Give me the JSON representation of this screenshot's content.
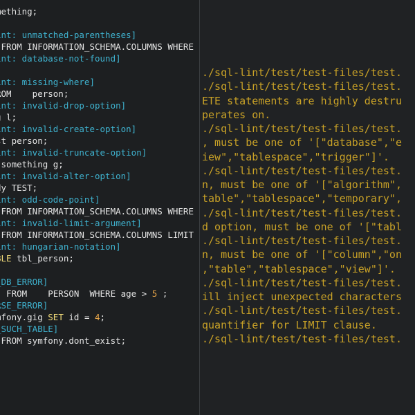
{
  "colors": {
    "background": "#1d1f21",
    "right_background": "#202224",
    "code_text": "#e6e6e6",
    "comment_cyan": "#3fb3d0",
    "keyword": "#f2dc7a",
    "number": "#e9a74a",
    "output_text": "#c9a227"
  },
  "editor": {
    "lines": [
      [
        {
          "t": "mething;",
          "c": "plain"
        }
      ],
      [
        {
          "t": "",
          "c": "plain"
        }
      ],
      [
        {
          "t": "int: unmatched-parentheses]",
          "c": "cyan"
        }
      ],
      [
        {
          "t": " FROM INFORMATION_SCHEMA.COLUMNS WHERE",
          "c": "plain"
        }
      ],
      [
        {
          "t": "int: database-not-found]",
          "c": "cyan"
        }
      ],
      [
        {
          "t": "",
          "c": "plain"
        }
      ],
      [
        {
          "t": "int: missing-where]",
          "c": "cyan"
        }
      ],
      [
        {
          "t": "ROM    person;",
          "c": "plain"
        }
      ],
      [
        {
          "t": "int: invalid-drop-option]",
          "c": "cyan"
        }
      ],
      [
        {
          "t": "g l;",
          "c": "plain"
        }
      ],
      [
        {
          "t": "int: invalid-create-option]",
          "c": "cyan"
        }
      ],
      [
        {
          "t": "st person;",
          "c": "plain"
        }
      ],
      [
        {
          "t": "int: invalid-truncate-option]",
          "c": "cyan"
        }
      ],
      [
        {
          "t": " something g;",
          "c": "plain"
        }
      ],
      [
        {
          "t": "int: invalid-alter-option]",
          "c": "cyan"
        }
      ],
      [
        {
          "t": "dy TEST;",
          "c": "plain"
        }
      ],
      [
        {
          "t": "int: odd-code-point]",
          "c": "cyan"
        }
      ],
      [
        {
          "t": " FROM INFORMATION_SCHEMA.COLUMNS WHERE",
          "c": "plain"
        }
      ],
      [
        {
          "t": "int: invalid-limit-argument]",
          "c": "cyan"
        }
      ],
      [
        {
          "t": " FROM INFORMATION_SCHEMA.COLUMNS LIMIT",
          "c": "plain"
        }
      ],
      [
        {
          "t": "int: hungarian-notation]",
          "c": "cyan"
        }
      ],
      [
        {
          "t": "BLE ",
          "c": "kw"
        },
        {
          "t": "tbl_person;",
          "c": "plain"
        }
      ],
      [
        {
          "t": "",
          "c": "plain"
        }
      ],
      [
        {
          "t": "_DB_ERROR]",
          "c": "cyan"
        }
      ],
      [
        {
          "t": "  FROM    PERSON  WHERE age > ",
          "c": "plain"
        },
        {
          "t": "5",
          "c": "num"
        },
        {
          "t": " ;",
          "c": "plain"
        }
      ],
      [
        {
          "t": "RSE_ERROR]",
          "c": "cyan"
        }
      ],
      [
        {
          "t": "mfony.gig ",
          "c": "plain"
        },
        {
          "t": "SET",
          "c": "kw"
        },
        {
          "t": " id = ",
          "c": "plain"
        },
        {
          "t": "4",
          "c": "num"
        },
        {
          "t": ";",
          "c": "plain"
        }
      ],
      [
        {
          "t": "_SUCH_TABLE]",
          "c": "cyan"
        }
      ],
      [
        {
          "t": " FROM symfony.dont_exist;",
          "c": "plain"
        }
      ]
    ]
  },
  "output": {
    "lines": [
      "./sql-lint/test/test-files/test.",
      "./sql-lint/test/test-files/test.",
      "ETE statements are highly destru",
      "perates on.",
      "./sql-lint/test/test-files/test.",
      ", must be one of '[\"database\",\"e",
      "iew\",\"tablespace\",\"trigger\"]'.",
      "./sql-lint/test/test-files/test.",
      "n, must be one of '[\"algorithm\",",
      "table\",\"tablespace\",\"temporary\",",
      "./sql-lint/test/test-files/test.",
      "d option, must be one of '[\"tabl",
      "./sql-lint/test/test-files/test.",
      "n, must be one of '[\"column\",\"on",
      ",\"table\",\"tablespace\",\"view\"]'.",
      "./sql-lint/test/test-files/test.",
      "ill inject unexpected characters",
      "./sql-lint/test/test-files/test.",
      "quantifier for LIMIT clause.",
      "./sql-lint/test/test-files/test."
    ]
  }
}
